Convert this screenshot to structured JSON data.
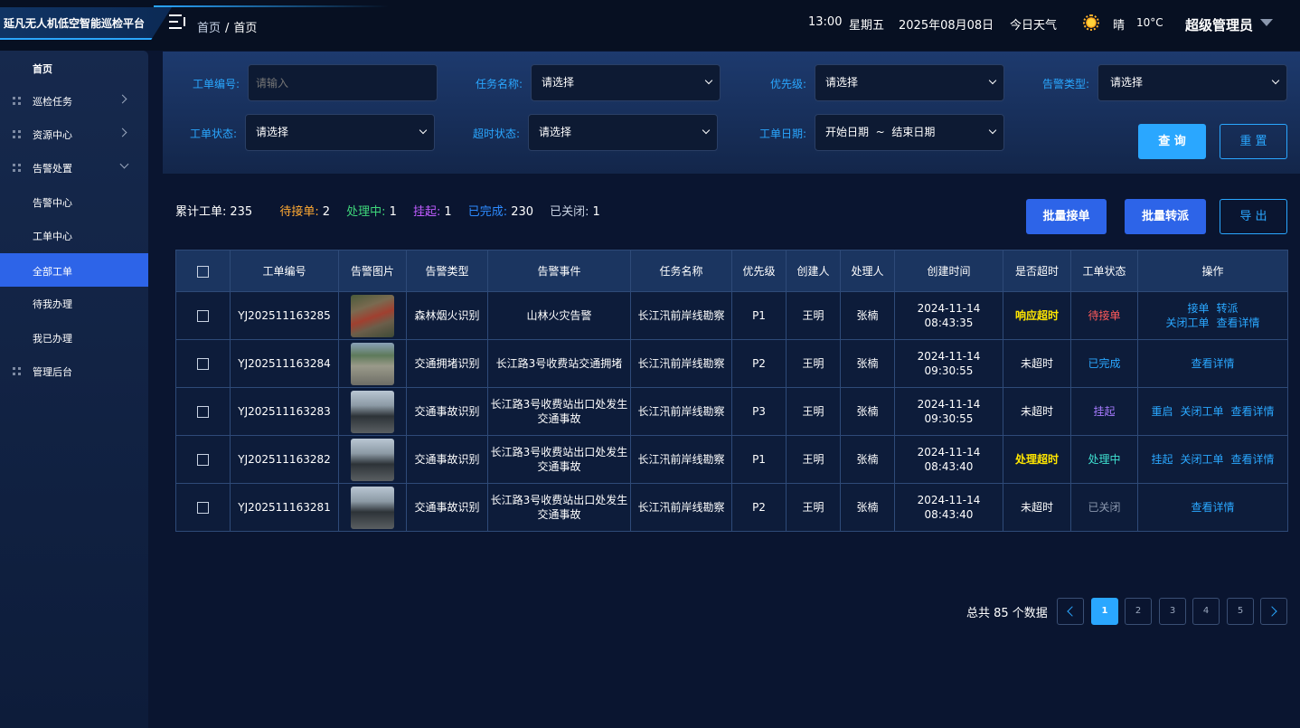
{
  "app": {
    "title": "延凡无人机低空智能巡检平台"
  },
  "breadcrumb": [
    "首页",
    "首页"
  ],
  "header": {
    "time": "13:00",
    "weekday": "星期五",
    "date": "2025年08月08日",
    "weather_label": "今日天气",
    "weather_icon": "sun-icon",
    "weather": "晴",
    "temperature": "10°C",
    "user": "超级管理员"
  },
  "sidebar": {
    "items": [
      {
        "label": "首页",
        "icon": "",
        "arrow": ""
      },
      {
        "label": "巡检任务",
        "icon": "grid-icon",
        "arrow": "right"
      },
      {
        "label": "资源中心",
        "icon": "grid-icon",
        "arrow": "right"
      },
      {
        "label": "告警处置",
        "icon": "grid-icon",
        "arrow": "down"
      },
      {
        "label": "告警中心",
        "icon": "",
        "arrow": ""
      },
      {
        "label": "工单中心",
        "icon": "",
        "arrow": ""
      },
      {
        "label": "全部工单",
        "icon": "",
        "arrow": "",
        "active": true
      },
      {
        "label": "待我办理",
        "icon": "",
        "arrow": ""
      },
      {
        "label": "我已办理",
        "icon": "",
        "arrow": ""
      },
      {
        "label": "管理后台",
        "icon": "grid-icon",
        "arrow": ""
      }
    ]
  },
  "filters": {
    "order_no": {
      "label": "工单编号:",
      "placeholder": "请输入"
    },
    "task_name": {
      "label": "任务名称:",
      "value": "请选择"
    },
    "priority": {
      "label": "优先级:",
      "value": "请选择"
    },
    "alarm_type": {
      "label": "告警类型:",
      "value": "请选择"
    },
    "order_status": {
      "label": "工单状态:",
      "value": "请选择"
    },
    "timeout_status": {
      "label": "超时状态:",
      "value": "请选择"
    },
    "order_date": {
      "label": "工单日期:",
      "value": "开始日期  ~  结束日期"
    },
    "query_label": "查 询",
    "reset_label": "重 置"
  },
  "stats": {
    "total_label": "累计工单:",
    "total": "235",
    "pending_label": "待接单:",
    "pending": "2",
    "processing_label": "处理中:",
    "processing": "1",
    "suspended_label": "挂起:",
    "suspended": "1",
    "completed_label": "已完成:",
    "completed": "230",
    "closed_label": "已关闭:",
    "closed": "1"
  },
  "actions": {
    "batch_accept": "批量接单",
    "batch_transfer": "批量转派",
    "export": "导 出"
  },
  "table": {
    "headers": [
      "工单编号",
      "告警图片",
      "告警类型",
      "告警事件",
      "任务名称",
      "优先级",
      "创建人",
      "处理人",
      "创建时间",
      "是否超时",
      "工单状态",
      "操作"
    ],
    "rows": [
      {
        "id": "YJ202511163285",
        "type": "森林烟火识别",
        "event": "山林火灾告警",
        "task": "长江汛前岸线勘察",
        "priority": "P1",
        "creator": "王明",
        "handler": "张楠",
        "time": "2024-11-14 08:43:35",
        "timeout": "响应超时",
        "timeout_color": "#ffe600",
        "status": "待接单",
        "status_color": "#ff5a5a",
        "ops": [
          "接单",
          "转派",
          "关闭工单",
          "查看详情"
        ]
      },
      {
        "id": "YJ202511163284",
        "type": "交通拥堵识别",
        "event": "长江路3号收费站交通拥堵",
        "task": "长江汛前岸线勘察",
        "priority": "P2",
        "creator": "王明",
        "handler": "张楠",
        "time": "2024-11-14 09:30:55",
        "timeout": "未超时",
        "timeout_color": "#ffffff",
        "status": "已完成",
        "status_color": "#2aa7ff",
        "ops": [
          "查看详情"
        ]
      },
      {
        "id": "YJ202511163283",
        "type": "交通事故识别",
        "event": "长江路3号收费站出口处发生交通事故",
        "task": "长江汛前岸线勘察",
        "priority": "P3",
        "creator": "王明",
        "handler": "张楠",
        "time": "2024-11-14 09:30:55",
        "timeout": "未超时",
        "timeout_color": "#ffffff",
        "status": "挂起",
        "status_color": "#a77bff",
        "ops": [
          "重启",
          "关闭工单",
          "查看详情"
        ]
      },
      {
        "id": "YJ202511163282",
        "type": "交通事故识别",
        "event": "长江路3号收费站出口处发生交通事故",
        "task": "长江汛前岸线勘察",
        "priority": "P1",
        "creator": "王明",
        "handler": "张楠",
        "time": "2024-11-14 08:43:40",
        "timeout": "处理超时",
        "timeout_color": "#ffe600",
        "status": "处理中",
        "status_color": "#3fe0d0",
        "ops": [
          "挂起",
          "关闭工单",
          "查看详情"
        ]
      },
      {
        "id": "YJ202511163281",
        "type": "交通事故识别",
        "event": "长江路3号收费站出口处发生交通事故",
        "task": "长江汛前岸线勘察",
        "priority": "P2",
        "creator": "王明",
        "handler": "张楠",
        "time": "2024-11-14 08:43:40",
        "timeout": "未超时",
        "timeout_color": "#ffffff",
        "status": "已关闭",
        "status_color": "#8a97ad",
        "ops": [
          "查看详情"
        ]
      }
    ]
  },
  "pagination": {
    "total_text": "总共 85 个数据",
    "pages": [
      "1",
      "2",
      "3",
      "4",
      "5"
    ],
    "current": "1"
  },
  "colors": {
    "accent": "#2aa7ff",
    "primary_blue": "#2d64e8",
    "pending": "#ffaa33",
    "processing": "#3fd67a",
    "suspended": "#c05cff",
    "completed": "#2d8bff"
  }
}
